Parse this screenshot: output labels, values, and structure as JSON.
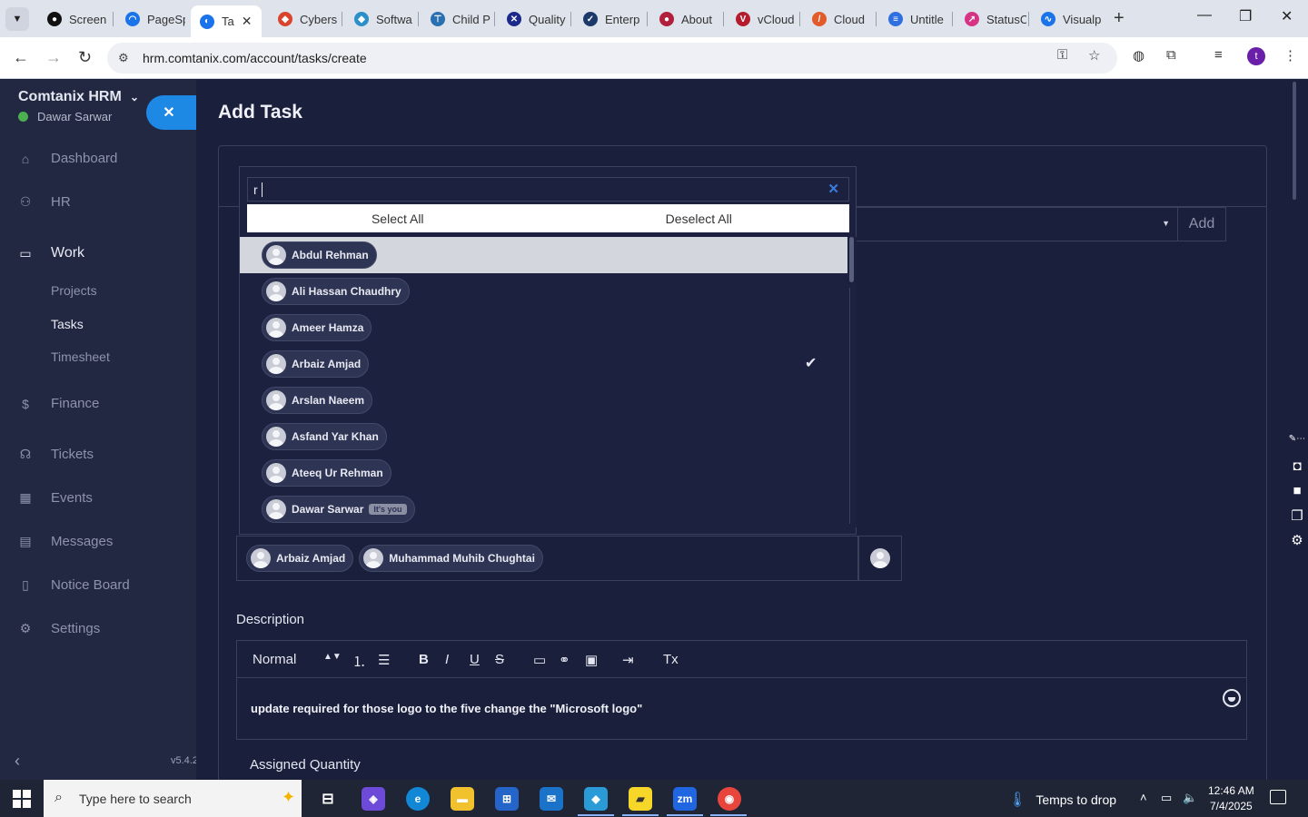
{
  "browser": {
    "tabs": [
      {
        "label": "Screen",
        "color": "#111",
        "glyph": "●"
      },
      {
        "label": "PageSp",
        "color": "#1a73e8",
        "glyph": "◠"
      },
      {
        "label": "Ta",
        "color": "#1a73e8",
        "glyph": "◐",
        "active": true
      },
      {
        "label": "Cybers",
        "color": "#d9452c",
        "glyph": "◆"
      },
      {
        "label": "Softwa",
        "color": "#2b8fc9",
        "glyph": "◆"
      },
      {
        "label": "Child P",
        "color": "#2a6fb0",
        "glyph": "⊤"
      },
      {
        "label": "Quality",
        "color": "#1b2a8a",
        "glyph": "✕"
      },
      {
        "label": "Enterp",
        "color": "#1b3a6a",
        "glyph": "✓"
      },
      {
        "label": "About",
        "color": "#b0203c",
        "glyph": "●"
      },
      {
        "label": "vCloud",
        "color": "#b51d2e",
        "glyph": "V"
      },
      {
        "label": "Cloud",
        "color": "#e25b2a",
        "glyph": "/"
      },
      {
        "label": "Untitle",
        "color": "#2f6fe0",
        "glyph": "≡"
      },
      {
        "label": "StatusC",
        "color": "#d63384",
        "glyph": "↗"
      },
      {
        "label": "Visualp",
        "color": "#1a73e8",
        "glyph": "∿"
      }
    ],
    "url": "hrm.comtanix.com/account/tasks/create",
    "profile_initial": "t"
  },
  "sidebar": {
    "brand": "Comtanix HRM",
    "user": "Dawar Sarwar",
    "items": [
      {
        "label": "Dashboard",
        "icon": "home-icon",
        "glyph": "⌂"
      },
      {
        "label": "HR",
        "icon": "users-icon",
        "glyph": "⚇"
      },
      {
        "label": "Work",
        "icon": "briefcase-icon",
        "glyph": "▭"
      },
      {
        "label": "Finance",
        "icon": "dollar-icon",
        "glyph": "$"
      },
      {
        "label": "Tickets",
        "icon": "headset-icon",
        "glyph": "☊"
      },
      {
        "label": "Events",
        "icon": "calendar-icon",
        "glyph": "▦"
      },
      {
        "label": "Messages",
        "icon": "message-icon",
        "glyph": "▤"
      },
      {
        "label": "Notice Board",
        "icon": "clipboard-icon",
        "glyph": "▯"
      },
      {
        "label": "Settings",
        "icon": "gear-icon",
        "glyph": "⚙"
      }
    ],
    "work_sub": [
      "Projects",
      "Tasks",
      "Timesheet"
    ],
    "version": "v5.4.2"
  },
  "page": {
    "title": "Add Task",
    "add_label": "Add",
    "description_label": "Description",
    "editor_format": "Normal",
    "description_text": "update required for those logo to the five change the \"Microsoft logo\"",
    "assigned_quantity_label": "Assigned Quantity",
    "assigned": [
      "Arbaiz Amjad",
      "Muhammad Muhib Chughtai"
    ]
  },
  "dropdown": {
    "search_value": "r",
    "select_all": "Select All",
    "deselect_all": "Deselect All",
    "options": [
      {
        "name": "Abdul Rehman",
        "highlighted": true
      },
      {
        "name": "Ali Hassan Chaudhry"
      },
      {
        "name": "Ameer Hamza"
      },
      {
        "name": "Arbaiz Amjad",
        "selected": true
      },
      {
        "name": "Arslan Naeem"
      },
      {
        "name": "Asfand Yar Khan"
      },
      {
        "name": "Ateeq Ur Rehman"
      },
      {
        "name": "Dawar Sarwar",
        "badge": "It's you"
      }
    ]
  },
  "taskbar": {
    "search_placeholder": "Type here to search",
    "weather": "Temps to drop",
    "time": "12:46 AM",
    "date": "7/4/2025"
  }
}
